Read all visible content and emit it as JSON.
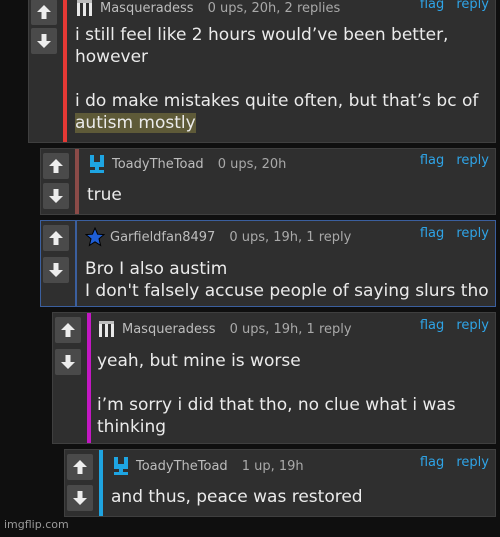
{
  "comments": [
    {
      "username": "Masqueradess",
      "meta": "0 ups, 20h, 2 replies",
      "flag": "flag",
      "reply": "reply",
      "line1": "i still feel like 2 hours would’ve been better,",
      "line2": "however",
      "line3": "i do make mistakes quite often, but that’s bc of",
      "line4": "autism mostly",
      "stripe_color": "#e53935"
    },
    {
      "username": "ToadyTheToad",
      "meta": "0 ups, 20h",
      "flag": "flag",
      "reply": "reply",
      "line1": "true",
      "stripe_color": "#8b4b48"
    },
    {
      "username": "Garfieldfan8497",
      "meta": "0 ups, 19h, 1 reply",
      "flag": "flag",
      "reply": "reply",
      "line1": "Bro I also austim",
      "line2": "I don't falsely accuse people of saying slurs tho",
      "stripe_color": "#3b5f9e"
    },
    {
      "username": "Masqueradess",
      "meta": "0 ups, 19h, 1 reply",
      "flag": "flag",
      "reply": "reply",
      "line1": "yeah, but mine is worse",
      "line2": "i’m sorry i did that tho, no clue what i was",
      "line3": "thinking",
      "stripe_color": "#c318c3"
    },
    {
      "username": "ToadyTheToad",
      "meta": "1 up, 19h",
      "flag": "flag",
      "reply": "reply",
      "line1": "and thus, peace was restored",
      "stripe_color": "#1fa4e0"
    }
  ],
  "watermark": "imgflip.com",
  "icons": {
    "upvote": "arrow-up-icon",
    "downvote": "arrow-down-icon"
  }
}
